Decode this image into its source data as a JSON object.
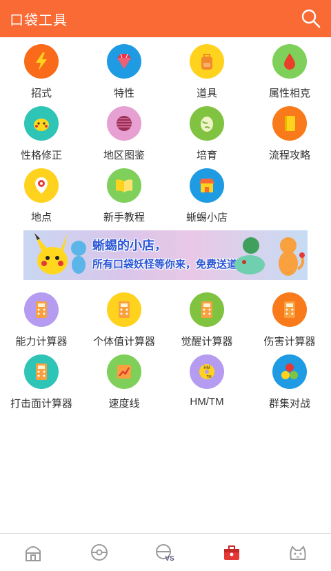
{
  "header": {
    "title": "口袋工具"
  },
  "tools": [
    {
      "label": "招式",
      "icon": "lightning-icon",
      "color": "#f96a1b"
    },
    {
      "label": "特性",
      "icon": "gem-icon",
      "color": "#1e9be3"
    },
    {
      "label": "道具",
      "icon": "backpack-icon",
      "color": "#ffd21e"
    },
    {
      "label": "属性相克",
      "icon": "water-drop-icon",
      "color": "#7fd05a"
    },
    {
      "label": "性格修正",
      "icon": "pikachu-face-icon",
      "color": "#2ec4b6"
    },
    {
      "label": "地区图鉴",
      "icon": "globe-icon",
      "color": "#e7a0d2"
    },
    {
      "label": "培育",
      "icon": "egg-icon",
      "color": "#7fc341"
    },
    {
      "label": "流程攻略",
      "icon": "book-icon",
      "color": "#f97a1b"
    },
    {
      "label": "地点",
      "icon": "location-pin-icon",
      "color": "#ffd21e"
    },
    {
      "label": "新手教程",
      "icon": "open-book-icon",
      "color": "#7fd05a"
    },
    {
      "label": "蜥蜴小店",
      "icon": "shop-icon",
      "color": "#1e9be3"
    }
  ],
  "banner": {
    "line1": "蜥蜴的小店，",
    "line2": "所有口袋妖怪等你来，免费送道具"
  },
  "calculators": [
    {
      "label": "能力计算器",
      "icon": "calculator-icon",
      "color": "#b59cf0"
    },
    {
      "label": "个体值计算器",
      "icon": "calculator-icon",
      "color": "#ffd21e"
    },
    {
      "label": "觉醒计算器",
      "icon": "calculator-icon",
      "color": "#7fc341"
    },
    {
      "label": "伤害计算器",
      "icon": "calculator-icon",
      "color": "#f97a1b"
    },
    {
      "label": "打击面计算器",
      "icon": "calculator-icon",
      "color": "#2ec4b6"
    },
    {
      "label": "速度线",
      "icon": "chart-up-icon",
      "color": "#7fd05a"
    },
    {
      "label": "HM/TM",
      "icon": "disc-icon",
      "color": "#b59cf0"
    },
    {
      "label": "群集对战",
      "icon": "balls-icon",
      "color": "#1e9be3"
    }
  ],
  "tabs": [
    {
      "icon": "home-icon"
    },
    {
      "icon": "pokeball-icon"
    },
    {
      "icon": "vs-icon"
    },
    {
      "icon": "toolbox-icon"
    },
    {
      "icon": "cat-face-icon"
    }
  ]
}
